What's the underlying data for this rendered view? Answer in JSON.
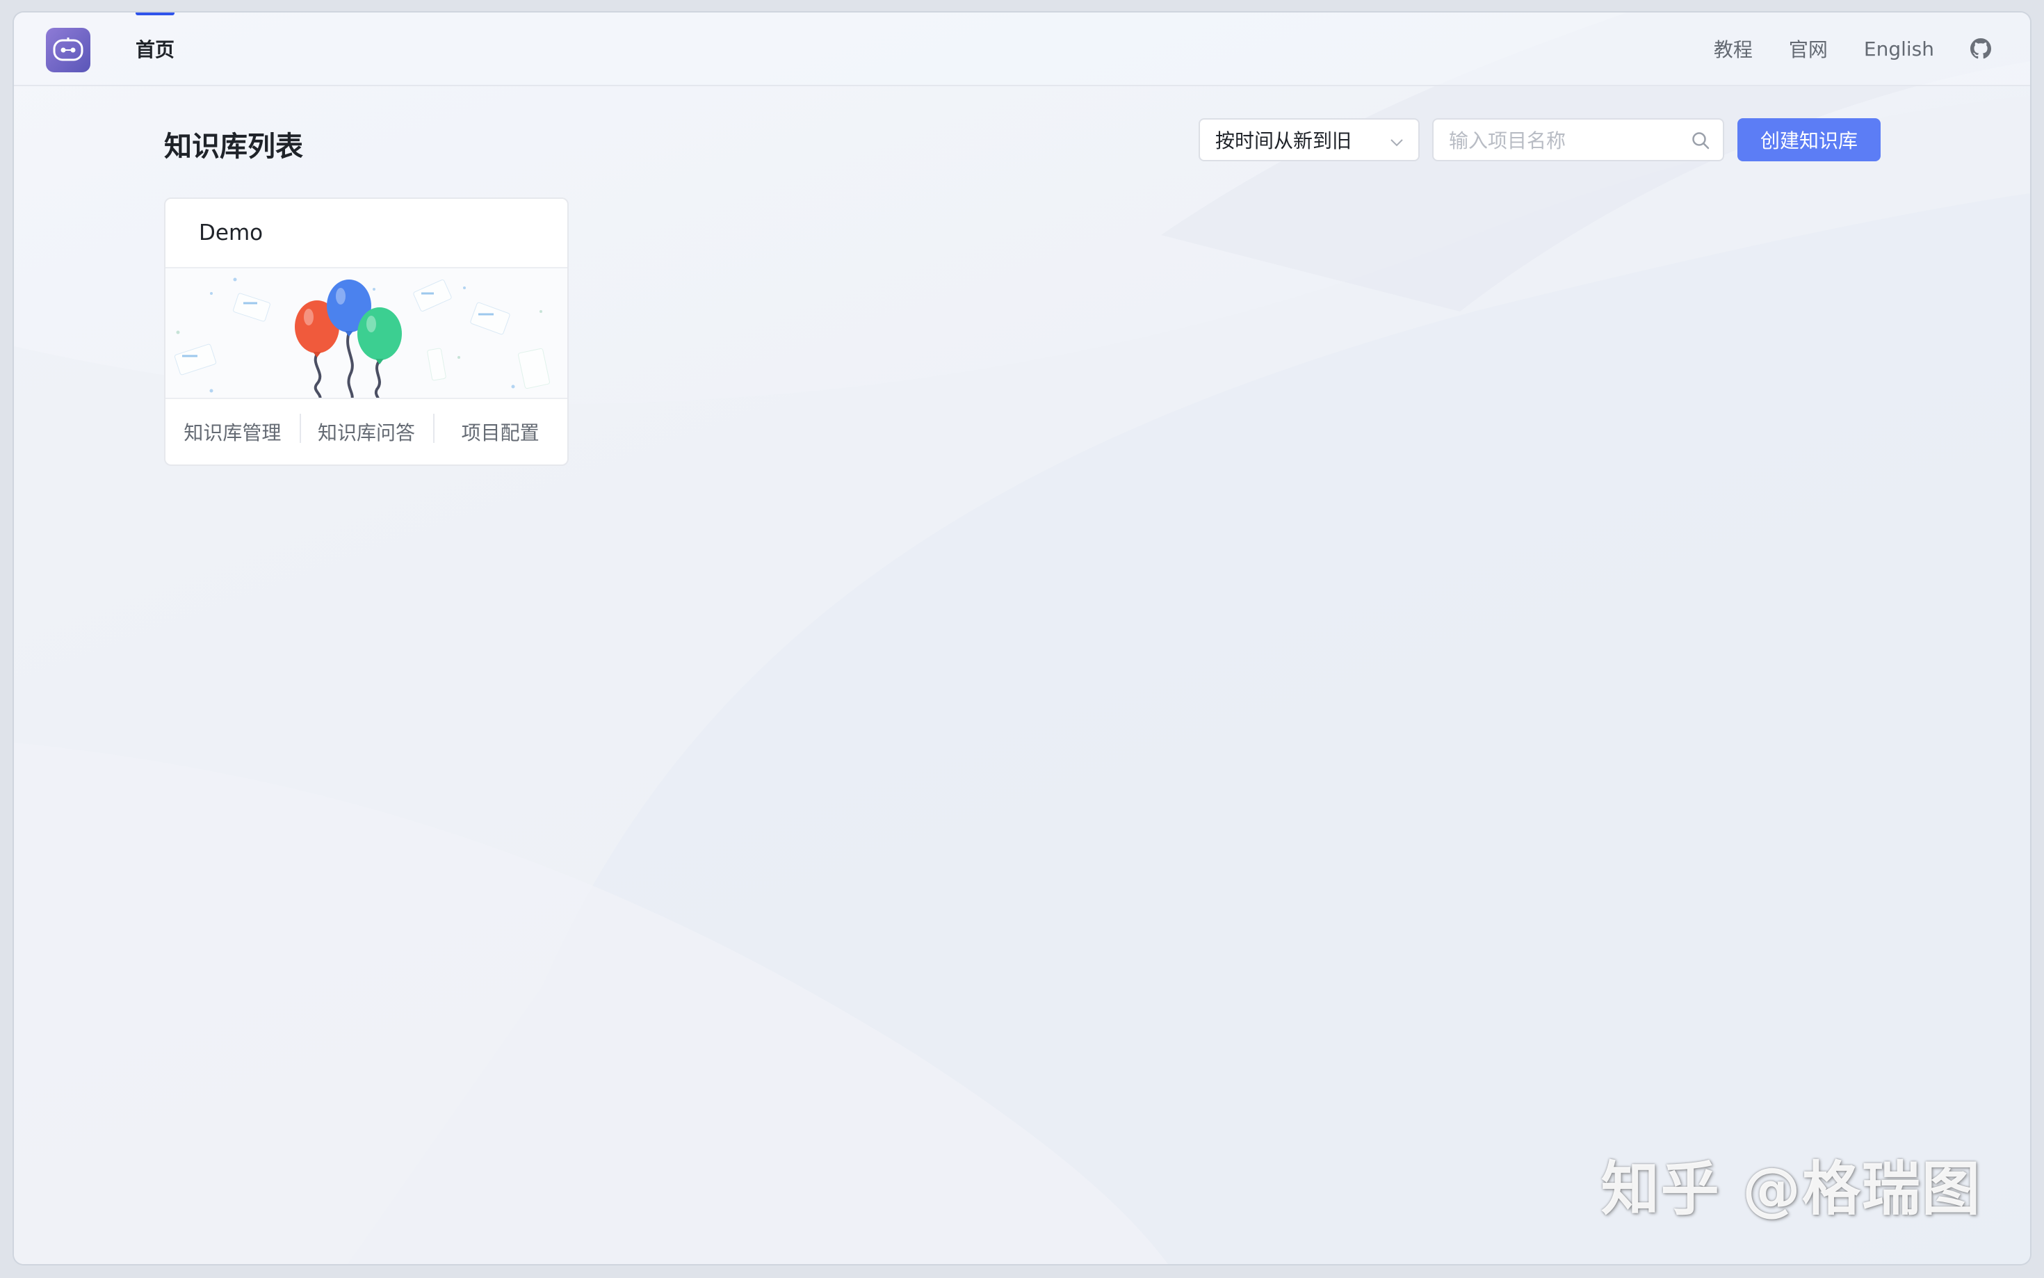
{
  "header": {
    "nav_home": "首页",
    "links": [
      "教程",
      "官网",
      "English"
    ],
    "icons": {
      "logo": "robot-brain-icon",
      "github": "github-icon"
    }
  },
  "main": {
    "title": "知识库列表",
    "sort": {
      "selected": "按时间从新到旧",
      "icon": "chevron-down-icon"
    },
    "search": {
      "placeholder": "输入项目名称",
      "value": "",
      "icon": "search-icon"
    },
    "create_button": "创建知识库",
    "cards": [
      {
        "title": "Demo",
        "cover": "balloons-illustration",
        "actions": [
          "知识库管理",
          "知识库问答",
          "项目配置"
        ]
      }
    ]
  },
  "watermark": "知乎 @格瑞图",
  "colors": {
    "primary": "#5c7df5",
    "nav_indicator": "#2f54eb",
    "logo": "#6f66c6",
    "text": "#1f2329",
    "muted_text": "#646a73"
  }
}
